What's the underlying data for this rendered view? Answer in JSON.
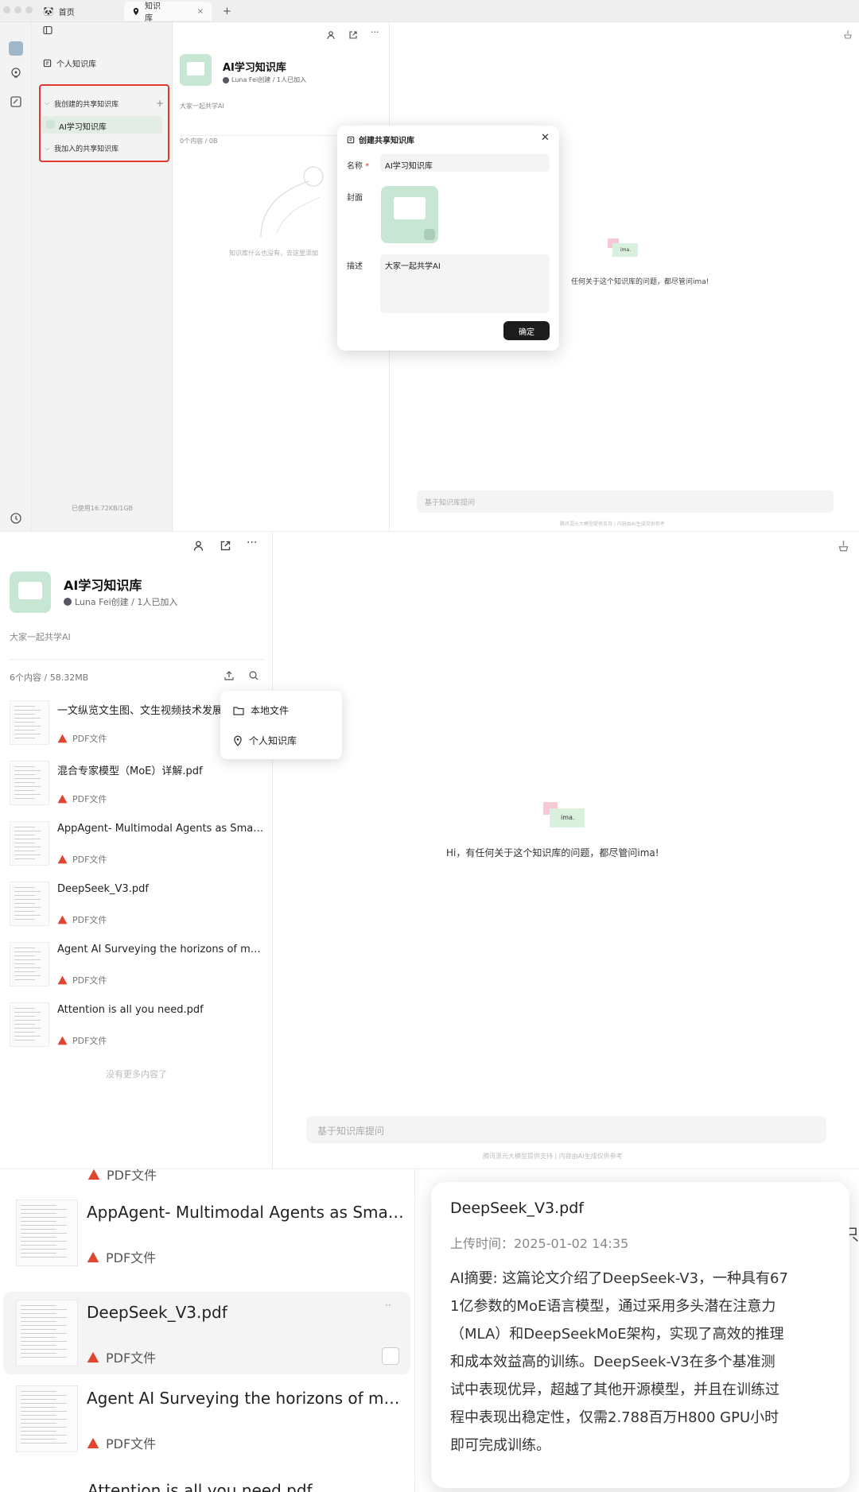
{
  "tabs": [
    {
      "label": "首页"
    },
    {
      "label": "知识库"
    }
  ],
  "sidebar": {
    "personal": "个人知识库",
    "created_group": "我创建的共享知识库",
    "active_item": "AI学习知识库",
    "joined_group": "我加入的共享知识库",
    "storage": "已使用16.72KB/1GB"
  },
  "kb": {
    "title": "AI学习知识库",
    "owner": "Luna Fei创建 / 1人已加入",
    "desc": "大家一起共学AI",
    "count_empty": "0个内容 / 0B",
    "empty_hint": "知识库什么也没有，去这里添加",
    "count": "6个内容 / 58.32MB",
    "no_more": "没有更多内容了"
  },
  "modal": {
    "title": "创建共享知识库",
    "name_label": "名称",
    "required_mark": "*",
    "name_value": "AI学习知识库",
    "cover_label": "封面",
    "desc_label": "描述",
    "desc_value": "大家一起共学AI",
    "confirm": "确定"
  },
  "chat": {
    "greeting_cut": "任何关于这个知识库的问题，都尽管问ima!",
    "greeting": "Hi，有任何关于这个知识库的问题，都尽管问ima!",
    "placeholder": "基于知识库提问",
    "footer": "腾讯混元大模型提供支持 | 内容由AI生成仅供参考",
    "logo_text": "ima."
  },
  "upload_menu": [
    {
      "label": "本地文件",
      "icon": "folder-icon"
    },
    {
      "label": "个人知识库",
      "icon": "location-pin-icon"
    }
  ],
  "files": [
    {
      "name": "一文纵览文生图、文生视频技术发展",
      "type": "PDF文件"
    },
    {
      "name": "混合专家模型（MoE）详解.pdf",
      "type": "PDF文件"
    },
    {
      "name": "AppAgent- Multimodal Agents as Smart...",
      "type": "PDF文件"
    },
    {
      "name": "DeepSeek_V3.pdf",
      "type": "PDF文件"
    },
    {
      "name": "Agent AI Surveying the horizons of muti...",
      "type": "PDF文件"
    },
    {
      "name": "Attention is all you need.pdf",
      "type": "PDF文件"
    }
  ],
  "zoom": {
    "top_cut_type": "PDF文件",
    "rows": [
      {
        "name": "AppAgent- Multimodal Agents as Smart...",
        "type": "PDF文件"
      },
      {
        "name": "DeepSeek_V3.pdf",
        "type": "PDF文件"
      },
      {
        "name": "Agent AI Surveying the horizons of muti...",
        "type": "PDF文件"
      }
    ],
    "bottom_cut": "Attention is all you need.pdf",
    "edge_char": "只"
  },
  "detail": {
    "title": "DeepSeek_V3.pdf",
    "upload_time": "上传时间：2025-01-02 14:35",
    "summary_lines": [
      "AI摘要: 这篇论文介绍了DeepSeek-V3，一种具有67",
      "1亿参数的MoE语言模型，通过采用多头潜在注意力",
      "（MLA）和DeepSeekMoE架构，实现了高效的推理",
      "和成本效益高的训练。DeepSeek-V3在多个基准测",
      "试中表现优异，超越了其他开源模型，并且在训练过",
      "程中表现出稳定性，仅需2.788百万H800 GPU小时",
      "即可完成训练。"
    ]
  },
  "colors": {
    "highlight_border": "#e2382f",
    "pdf_red": "#e0452f",
    "cover_green": "#c7e6d3",
    "button_dark": "#1c1c1c"
  }
}
